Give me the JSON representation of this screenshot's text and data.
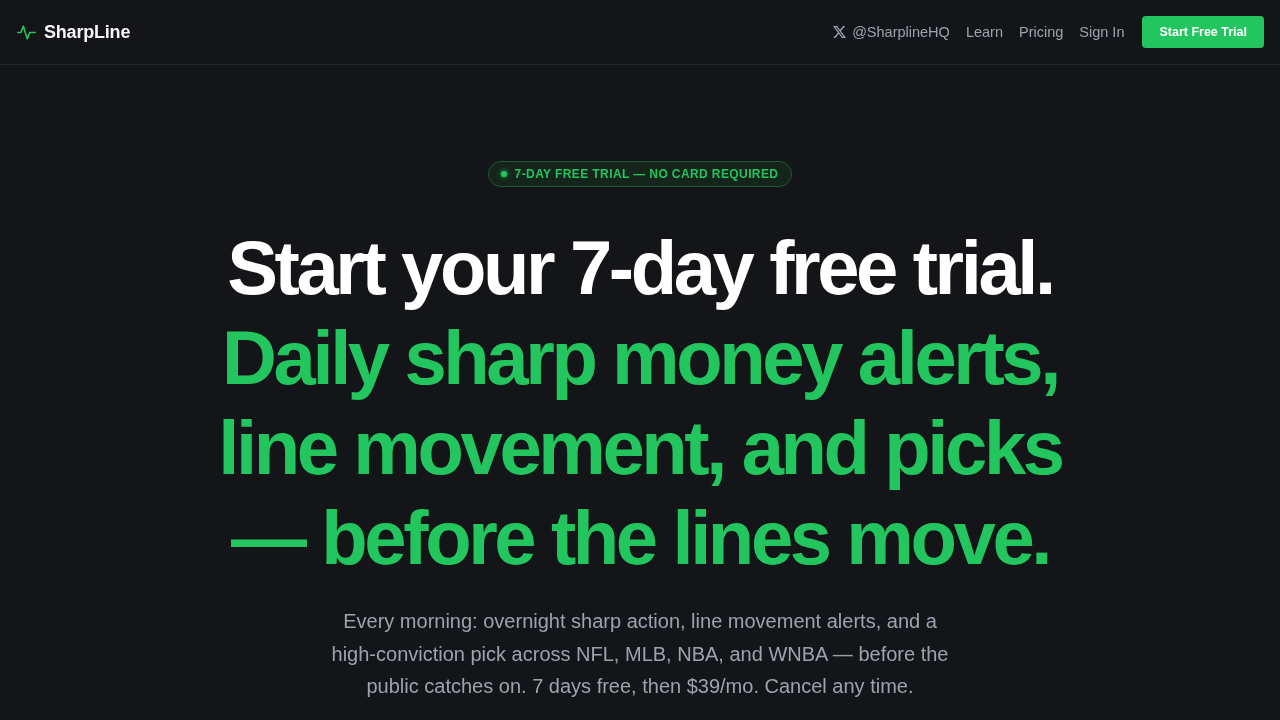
{
  "nav": {
    "brand": "SharpLine",
    "social": "@SharplineHQ",
    "links": [
      "Learn",
      "Pricing",
      "Sign In"
    ],
    "cta": "Start Free Trial"
  },
  "hero": {
    "badge": "7-DAY FREE TRIAL — NO CARD REQUIRED",
    "headline_lead": "Start your 7-day free trial.",
    "headline_highlight": "Daily sharp money alerts, line movement, and picks — before the lines move.",
    "description": "Every morning: overnight sharp action, line movement alerts, and a high-conviction pick across NFL, MLB, NBA, and WNBA — before the public catches on. 7 days free, then $39/mo. Cancel any time."
  }
}
